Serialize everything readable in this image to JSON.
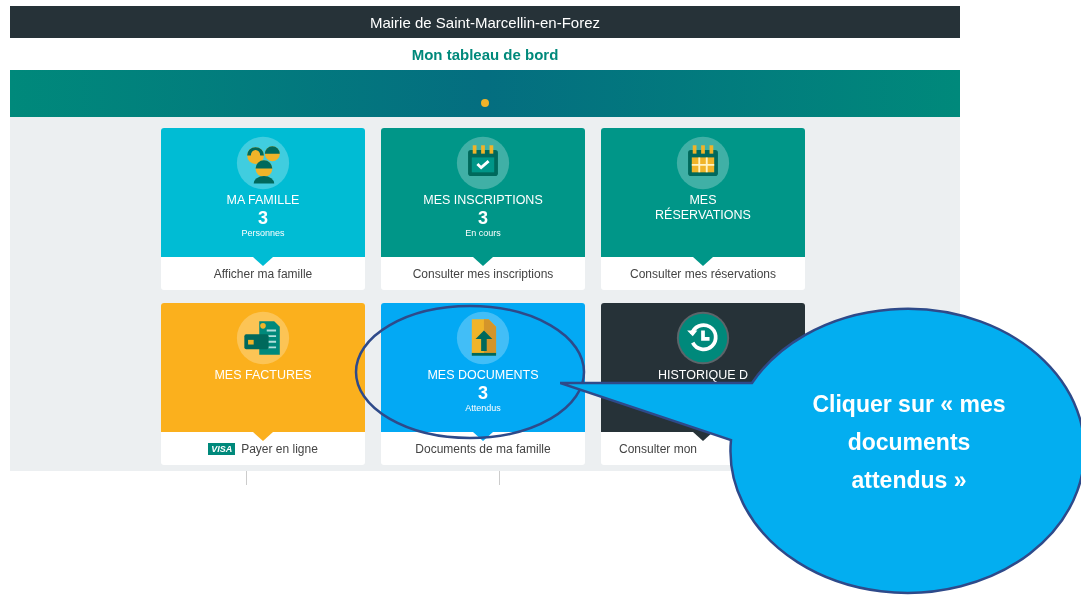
{
  "header": {
    "title": "Mairie de Saint-Marcellin-en-Forez",
    "subtitle": "Mon tableau de bord"
  },
  "cards": [
    {
      "kind": "family",
      "color": "#00bcd4",
      "title": [
        "MA FAMILLE"
      ],
      "count": "3",
      "count_label": "Personnes",
      "link": "Afficher ma famille"
    },
    {
      "kind": "calendar-check",
      "color": "#009688",
      "title": [
        "MES INSCRIPTIONS"
      ],
      "count": "3",
      "count_label": "En cours",
      "link": "Consulter mes inscriptions"
    },
    {
      "kind": "calendar-grid",
      "color": "#009688",
      "title": [
        "MES",
        "RÉSERVATIONS"
      ],
      "link": "Consulter mes réservations"
    },
    {
      "kind": "invoice",
      "color": "#fbb01d",
      "title": [
        "MES FACTURES"
      ],
      "badge": "VISA",
      "link": "Payer en ligne"
    },
    {
      "kind": "document",
      "color": "#03a9f4",
      "title": [
        "MES DOCUMENTS"
      ],
      "count": "3",
      "count_label": "Attendus",
      "link": "Documents de ma famille"
    },
    {
      "kind": "history",
      "color": "#263238",
      "title": [
        "HISTORIQUE D"
      ],
      "link": "Consulter mon"
    }
  ],
  "callout": {
    "text": "Cliquer sur « mes documents attendus »"
  }
}
